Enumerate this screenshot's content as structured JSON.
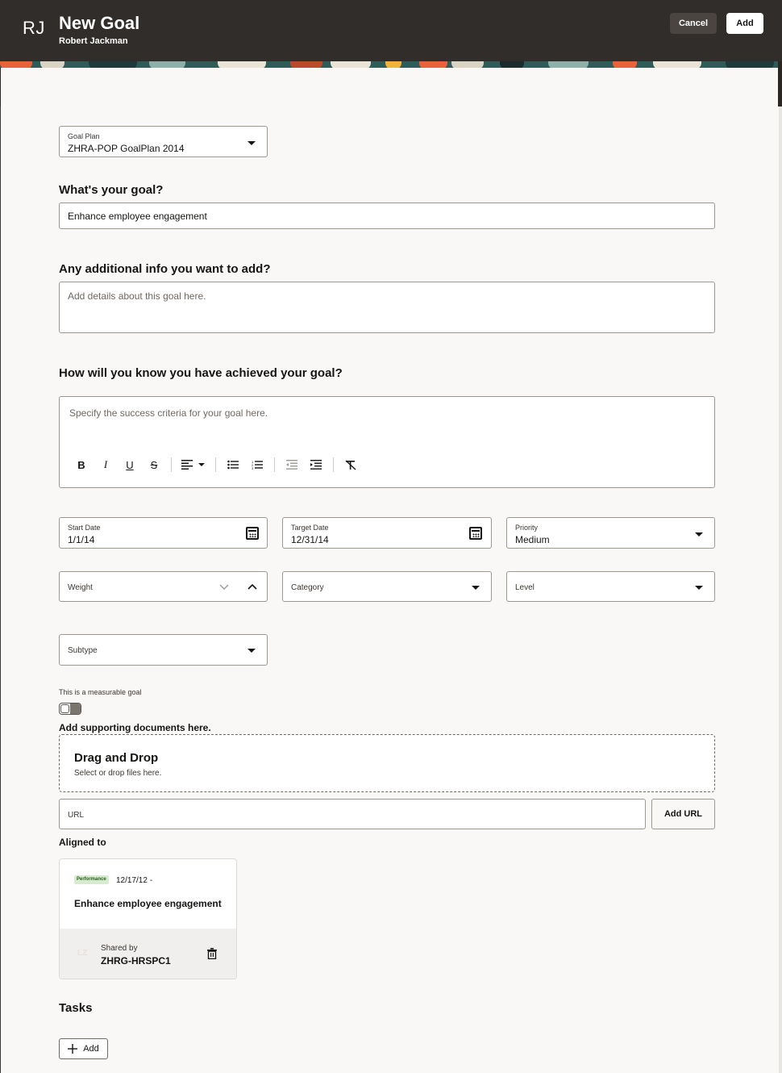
{
  "header": {
    "initials": "RJ",
    "title": "New Goal",
    "subtitle": "Robert Jackman",
    "cancel_label": "Cancel",
    "add_label": "Add"
  },
  "goal_plan": {
    "label": "Goal Plan",
    "value": "ZHRA-POP GoalPlan 2014"
  },
  "goal": {
    "heading": "What's your goal?",
    "value": "Enhance employee engagement"
  },
  "additional": {
    "heading": "Any additional info you want to add?",
    "placeholder": "Add details about this goal here."
  },
  "success": {
    "heading": "How will you know you have achieved your goal?",
    "placeholder": "Specify the success criteria for your goal here."
  },
  "start_date": {
    "label": "Start Date",
    "value": "1/1/14"
  },
  "target_date": {
    "label": "Target Date",
    "value": "12/31/14"
  },
  "priority": {
    "label": "Priority",
    "value": "Medium"
  },
  "weight": {
    "label": "Weight"
  },
  "category": {
    "label": "Category"
  },
  "level": {
    "label": "Level"
  },
  "subtype": {
    "label": "Subtype"
  },
  "measurable": {
    "label": "This is a measurable goal",
    "on": false
  },
  "documents": {
    "heading": "Add supporting documents here.",
    "drop_title": "Drag and Drop",
    "drop_sub": "Select or drop files here.",
    "url_placeholder": "URL",
    "add_url_label": "Add URL"
  },
  "aligned": {
    "heading": "Aligned to",
    "badge": "Performance",
    "date": "12/17/12 -",
    "title": "Enhance employee engagement",
    "initials": "LZ",
    "shared_label": "Shared by",
    "shared_by": "ZHRG-HRSPC1"
  },
  "tasks": {
    "heading": "Tasks",
    "add_label": "Add"
  }
}
